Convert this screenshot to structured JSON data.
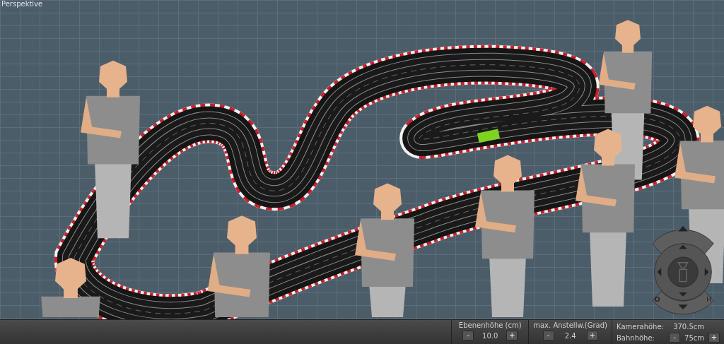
{
  "viewport": {
    "label": "Perspektive"
  },
  "controls": [
    {
      "kind": "stepper",
      "label": "Ebenenhöhe (cm)",
      "value": "10.0",
      "minus": "-",
      "plus": "+"
    },
    {
      "kind": "stepper",
      "label": "max. Anstellw.(Grad)",
      "value": "2.4",
      "minus": "-",
      "plus": "+"
    },
    {
      "kind": "camera",
      "rows": [
        {
          "label": "Kamerahöhe:",
          "value": "370.5cm"
        },
        {
          "label": "Bahnhöhe:",
          "value": "75cm",
          "minus": "-",
          "plus": "+"
        }
      ]
    }
  ],
  "nav": {
    "home_label": "H"
  }
}
